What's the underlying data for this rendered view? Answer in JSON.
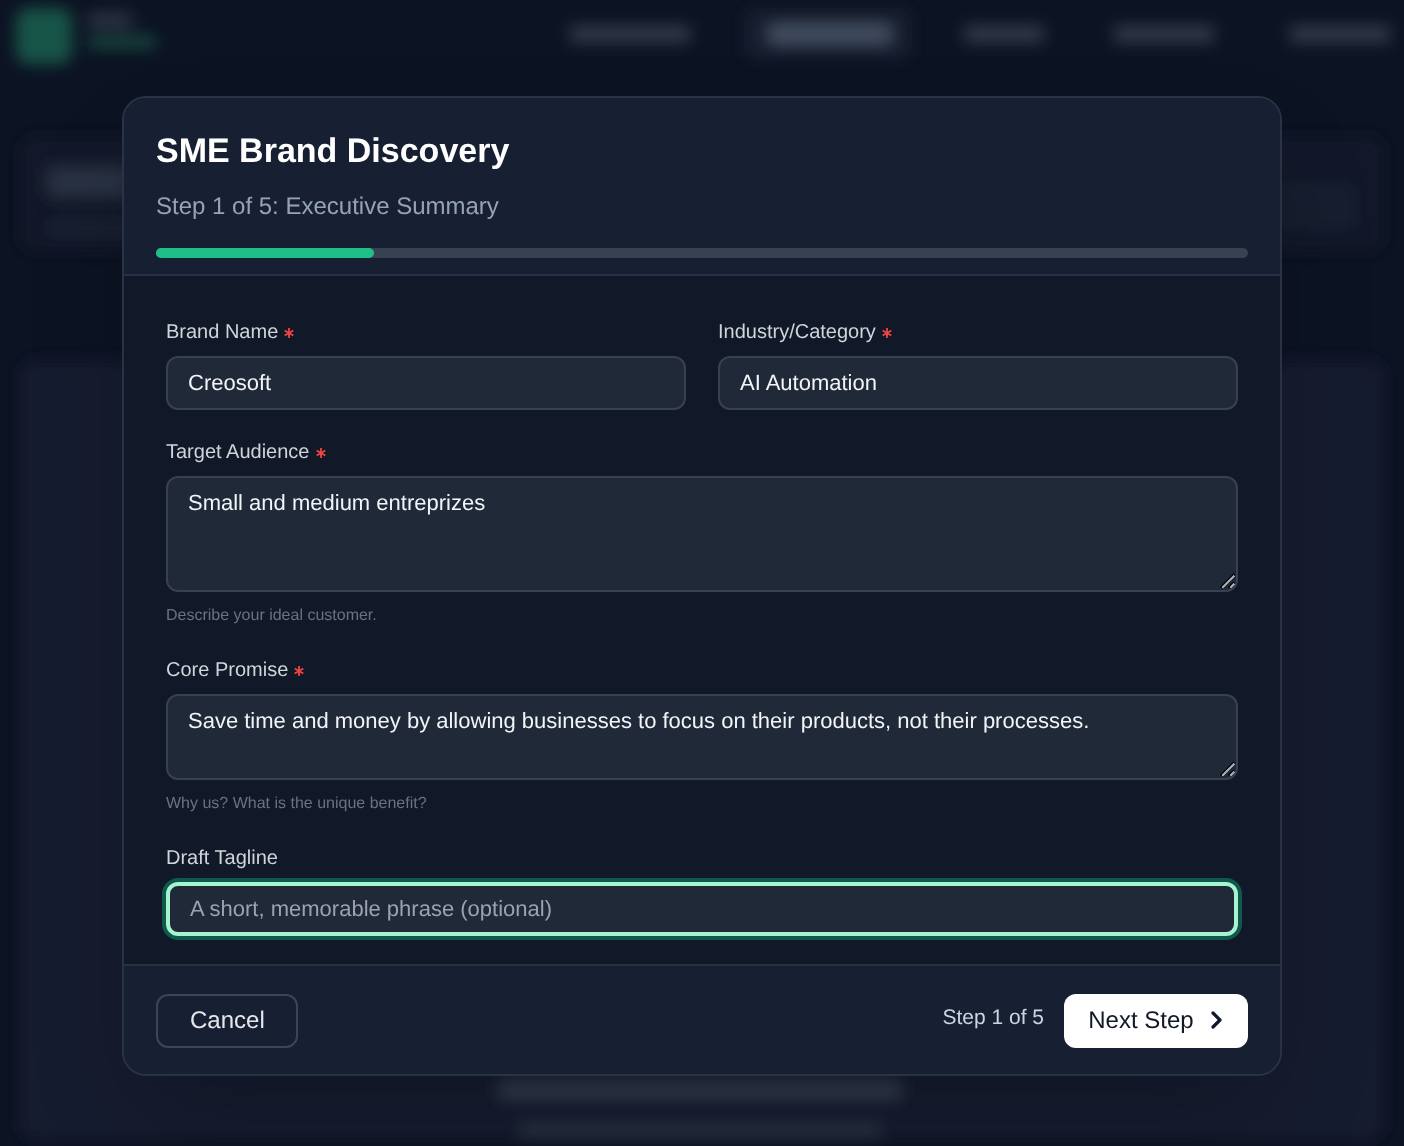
{
  "dialog": {
    "title": "SME Brand Discovery",
    "subtitle": "Step 1 of 5: Executive Summary",
    "progress": {
      "level": 0.2
    }
  },
  "fields": [
    {
      "kind": "text",
      "label": "Brand Name",
      "required": true,
      "value": "Creosoft"
    },
    {
      "kind": "text",
      "label": "Industry/Category",
      "required": true,
      "value": "AI Automation"
    },
    {
      "kind": "textarea",
      "label": "Target Audience",
      "required": true,
      "value": "Small and medium entreprizes",
      "hint": "Describe your ideal customer."
    },
    {
      "kind": "textarea",
      "label": "Core Promise",
      "required": true,
      "value": "Save time and money by allowing businesses to focus on their products, not their processes.",
      "hint": "Why us? What is the unique benefit?"
    },
    {
      "kind": "text",
      "label": "Draft Tagline",
      "required": false,
      "placeholder": "A short, memorable phrase (optional)",
      "focused": true
    }
  ],
  "footer": {
    "cancel": "Cancel",
    "step": "Step 1 of 5",
    "next": "Next Step"
  }
}
